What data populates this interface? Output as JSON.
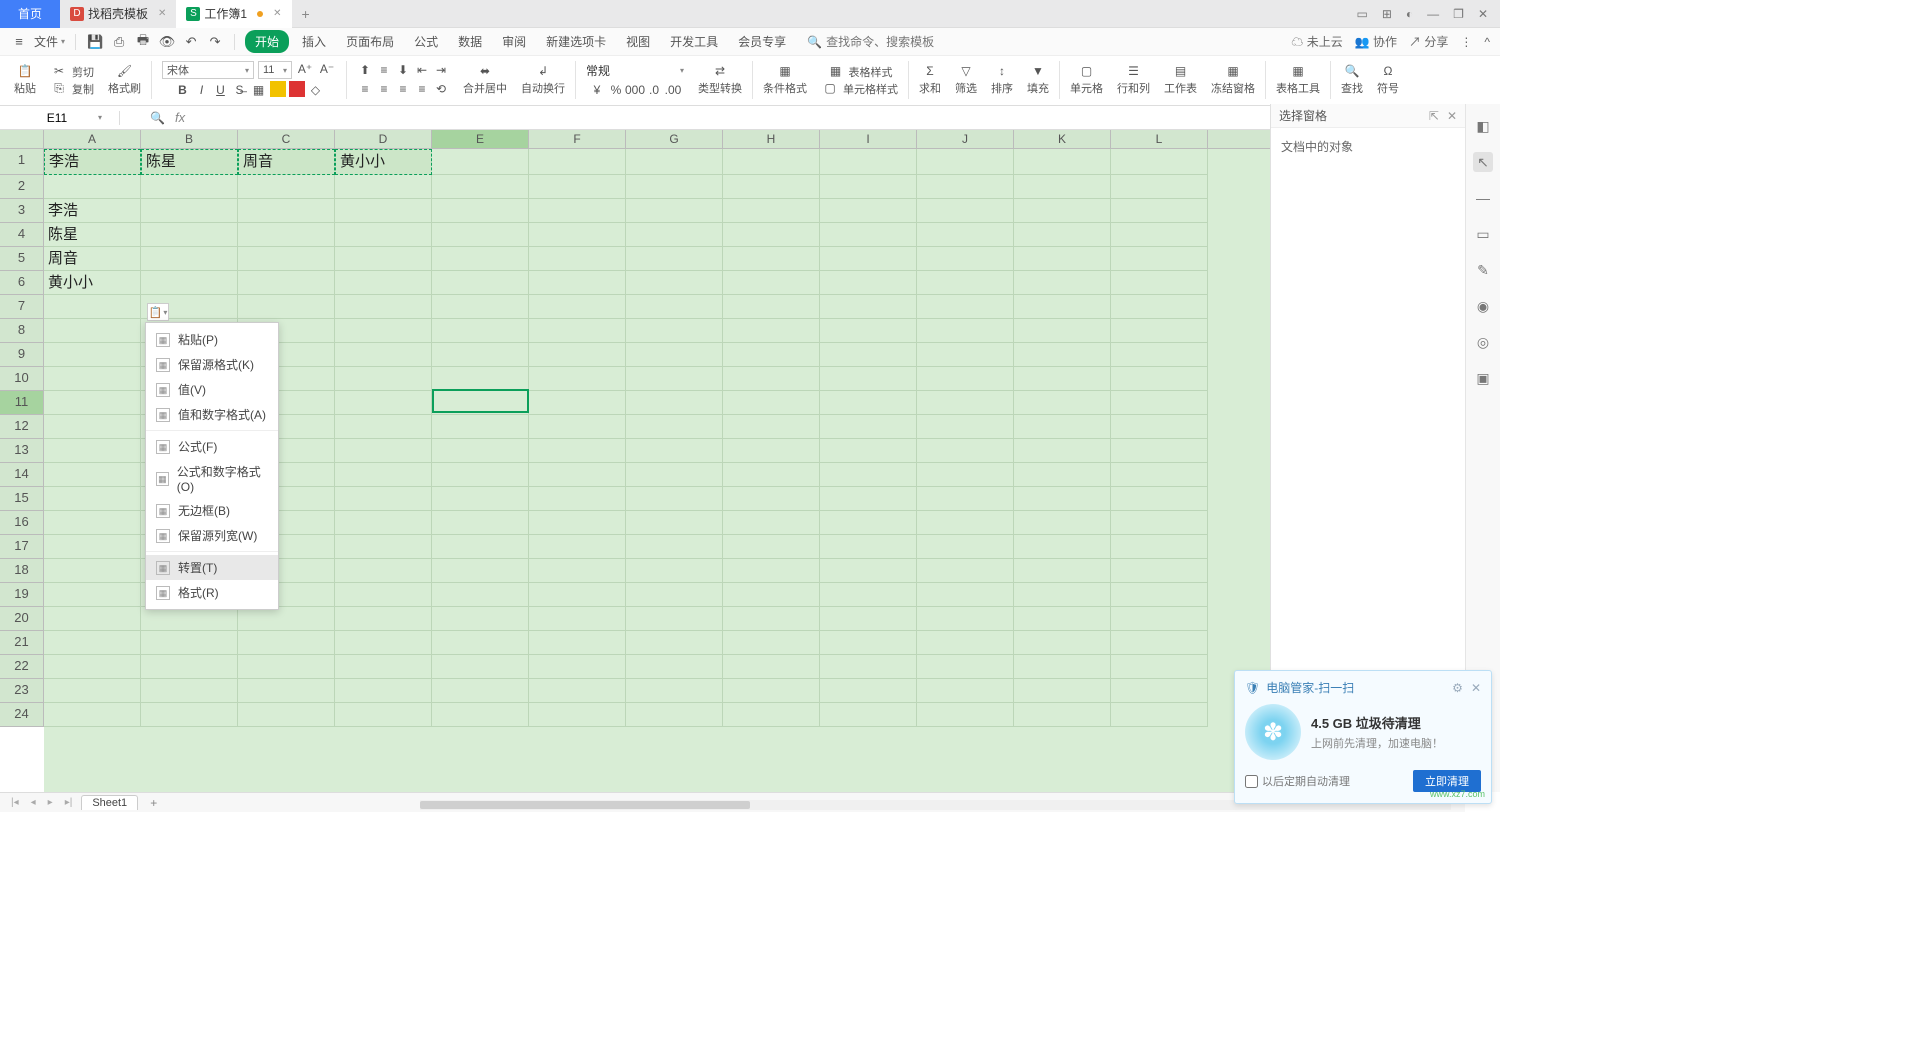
{
  "titlebar": {
    "tabs": [
      {
        "label": "首页",
        "type": "home"
      },
      {
        "label": "找稻壳模板",
        "icon": "red"
      },
      {
        "label": "工作簿1",
        "icon": "green",
        "active": true,
        "dirty": true
      }
    ]
  },
  "menubar": {
    "file": "文件",
    "tabs": [
      "开始",
      "插入",
      "页面布局",
      "公式",
      "数据",
      "审阅",
      "新建选项卡",
      "视图",
      "开发工具",
      "会员专享"
    ],
    "active": "开始",
    "searchPlaceholder": "查找命令、搜索模板",
    "right": {
      "cloud": "未上云",
      "coop": "协作",
      "share": "分享"
    }
  },
  "ribbon": {
    "paste": "粘贴",
    "cut": "剪切",
    "copy": "复制",
    "fmtPainter": "格式刷",
    "font": "宋体",
    "size": "11",
    "merge": "合并居中",
    "wrap": "自动换行",
    "numFmt": "常规",
    "typeConv": "类型转换",
    "condFmt": "条件格式",
    "tableStyle": "表格样式",
    "cellStyle": "单元格样式",
    "sum": "求和",
    "filter": "筛选",
    "sort": "排序",
    "fill": "填充",
    "cell": "单元格",
    "rowcol": "行和列",
    "worksheet": "工作表",
    "freeze": "冻结窗格",
    "tableTool": "表格工具",
    "find": "查找",
    "symbol": "符号"
  },
  "formulabar": {
    "cellref": "E11"
  },
  "grid": {
    "cols": [
      "A",
      "B",
      "C",
      "D",
      "E",
      "F",
      "G",
      "H",
      "I",
      "J",
      "K",
      "L"
    ],
    "activeCol": "E",
    "rows": 24,
    "activeRow": 11,
    "data": {
      "r1": [
        "李浩",
        "陈星",
        "周音",
        "黄小小"
      ],
      "rA": {
        "3": "李浩",
        "4": "陈星",
        "5": "周音",
        "6": "黄小小"
      }
    }
  },
  "pasteMenu": {
    "items": [
      {
        "label": "粘贴(P)"
      },
      {
        "label": "保留源格式(K)"
      },
      {
        "label": "值(V)"
      },
      {
        "label": "值和数字格式(A)"
      },
      {
        "sep": true
      },
      {
        "label": "公式(F)"
      },
      {
        "label": "公式和数字格式(O)"
      },
      {
        "label": "无边框(B)"
      },
      {
        "label": "保留源列宽(W)"
      },
      {
        "sep": true
      },
      {
        "label": "转置(T)",
        "hover": true
      },
      {
        "label": "格式(R)"
      }
    ]
  },
  "sidepanel": {
    "title": "选择窗格",
    "body": "文档中的对象"
  },
  "sheettabs": {
    "sheet": "Sheet1"
  },
  "toast": {
    "title": "电脑管家-扫一扫",
    "line1": "4.5 GB 垃圾待清理",
    "line2": "上网前先清理，加速电脑！",
    "checkbox": "以后定期自动清理",
    "button": "立即清理",
    "wm": "www.xz7.com"
  }
}
